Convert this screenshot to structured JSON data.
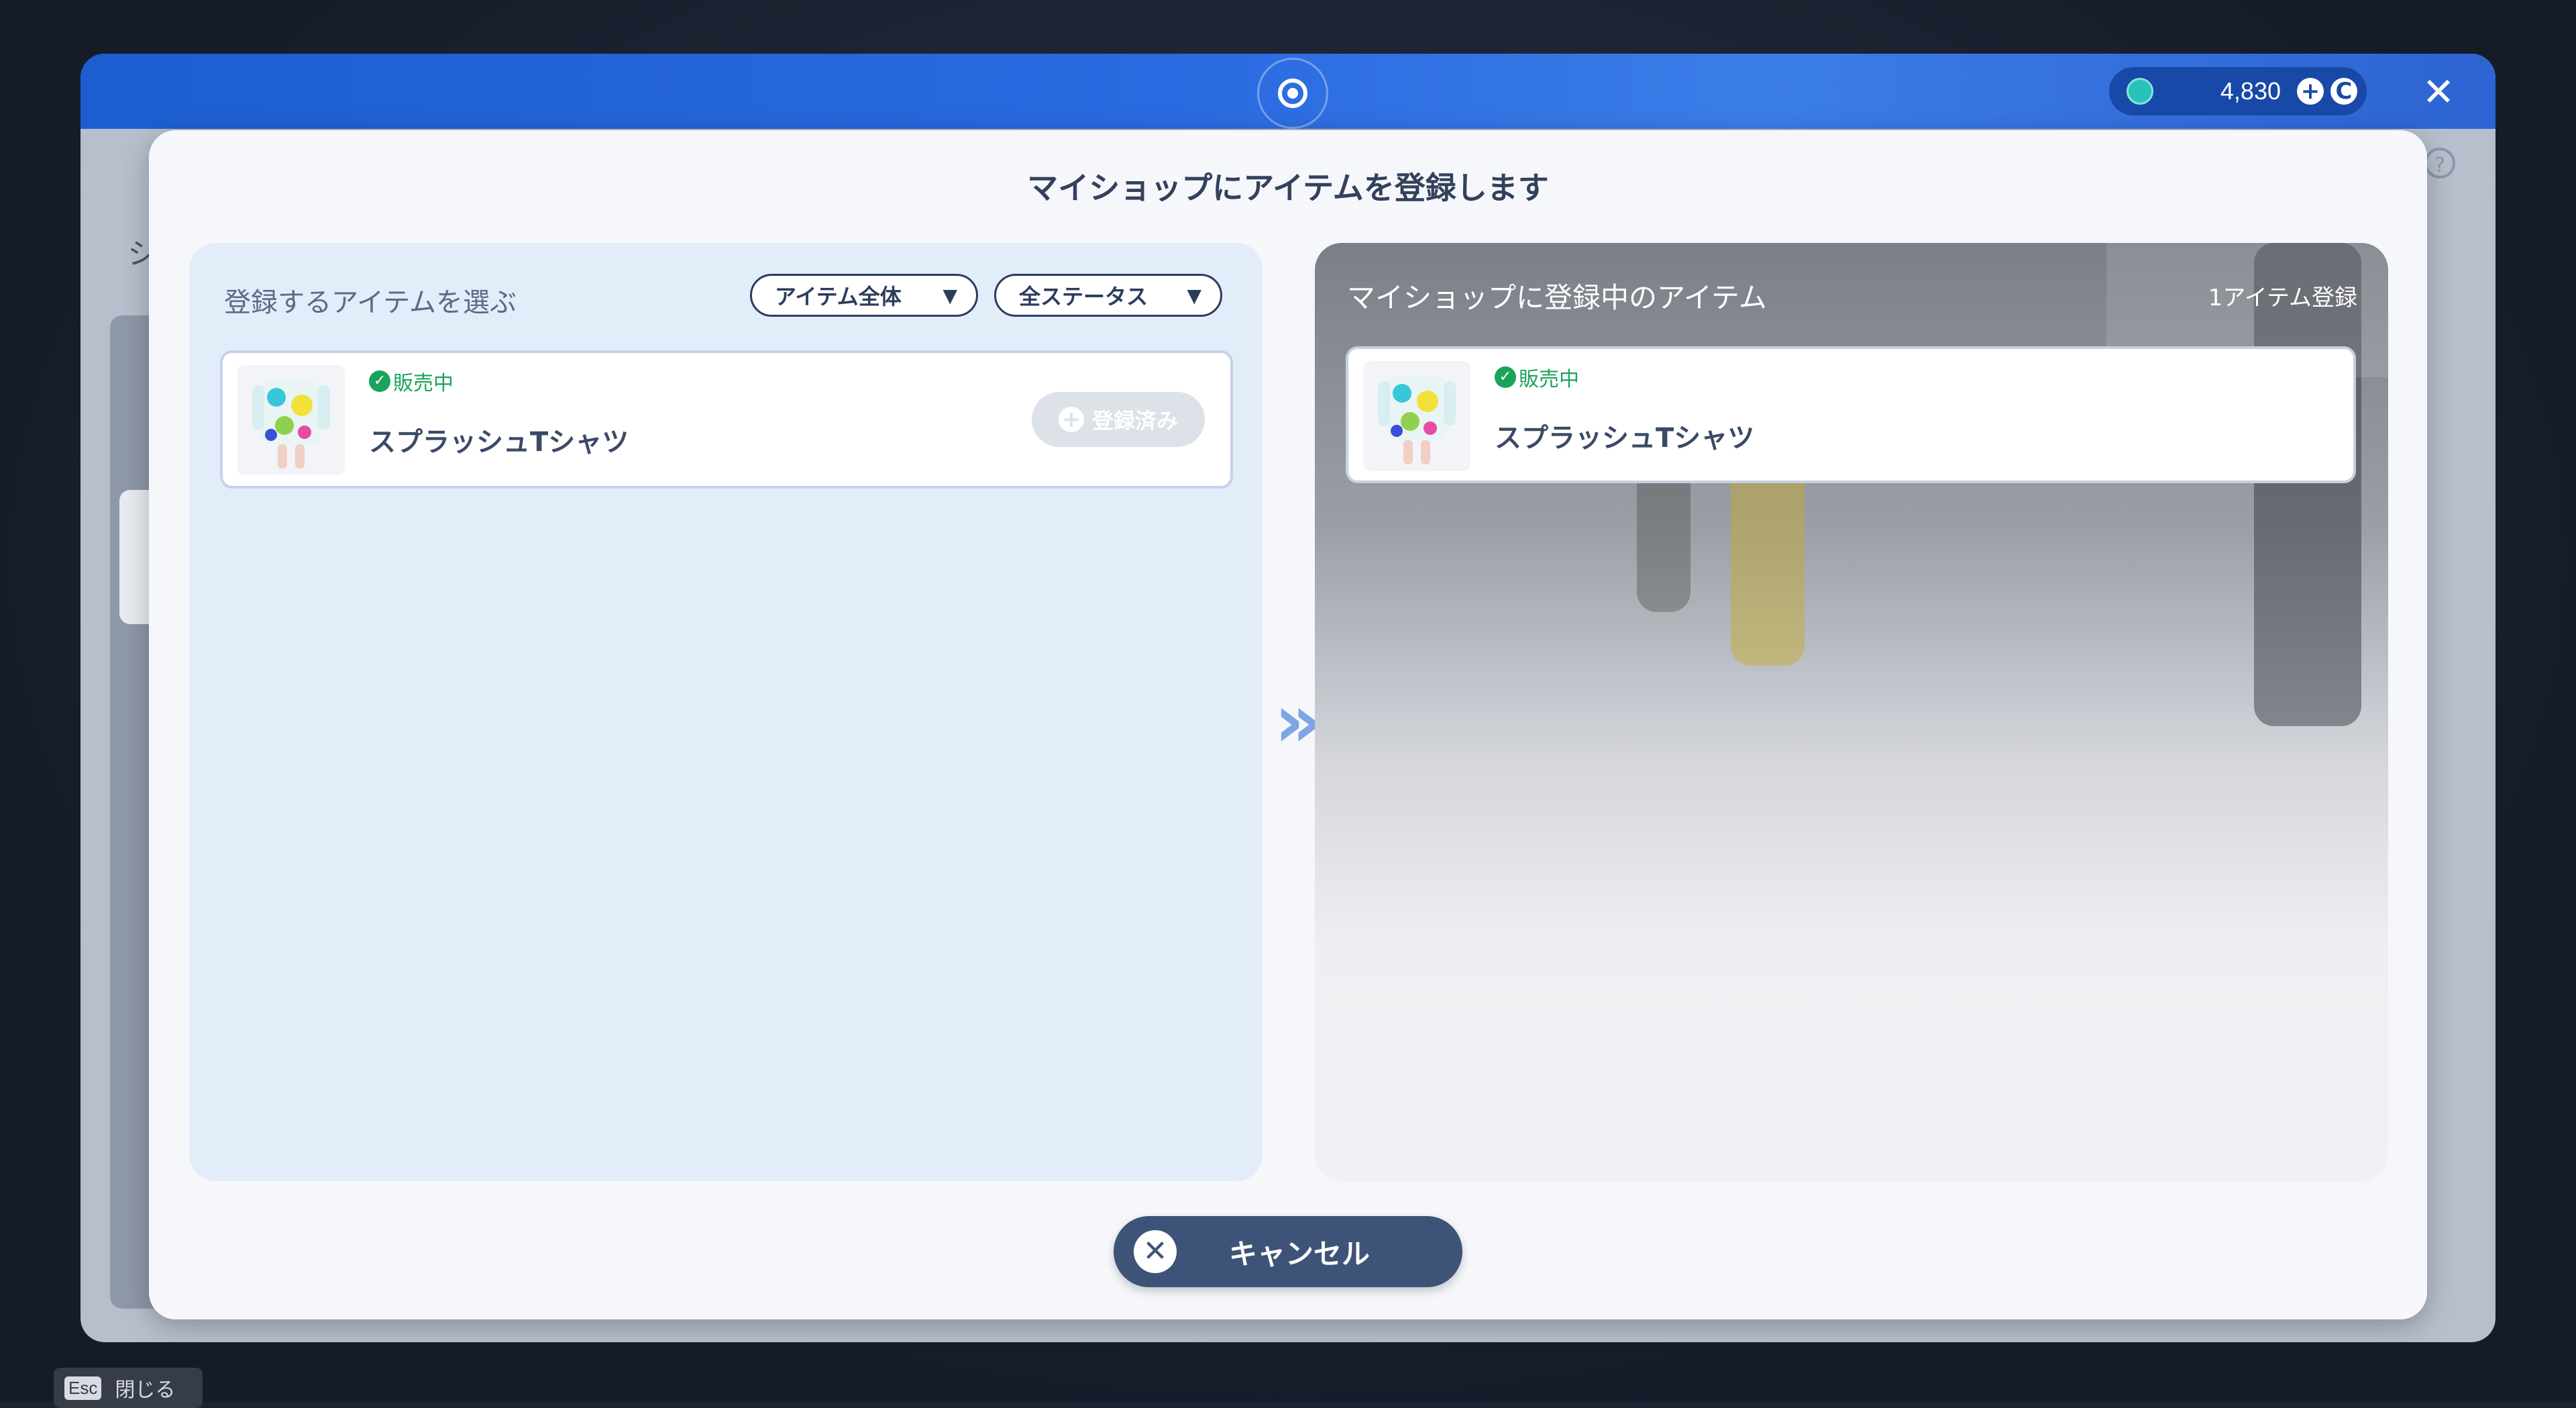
{
  "header": {
    "currency_amount": "4,830",
    "add_currency_symbol": "+",
    "coin_symbol": "C",
    "close_symbol": "✕"
  },
  "background": {
    "side_label": "シ",
    "help_symbol": "?"
  },
  "modal": {
    "title": "マイショップにアイテムを登録します",
    "left_panel": {
      "heading": "登録するアイテムを選ぶ",
      "filter_category": "アイテム全体",
      "filter_status": "全ステータス",
      "items": [
        {
          "status": "販売中",
          "name": "スプラッシュTシャツ",
          "action_label": "登録済み"
        }
      ]
    },
    "transfer_symbol": "»",
    "right_panel": {
      "heading": "マイショップに登録中のアイテム",
      "count_label": "1アイテム登録",
      "items": [
        {
          "status": "販売中",
          "name": "スプラッシュTシャツ"
        }
      ]
    },
    "cancel_label": "キャンセル"
  },
  "footer": {
    "esc_key": "Esc",
    "esc_label": "閉じる"
  },
  "colors": {
    "header_blue": "#2a6ae0",
    "status_green": "#1aa35b",
    "cancel_button": "#3d5478",
    "left_panel_bg": "#e3ecf9"
  }
}
